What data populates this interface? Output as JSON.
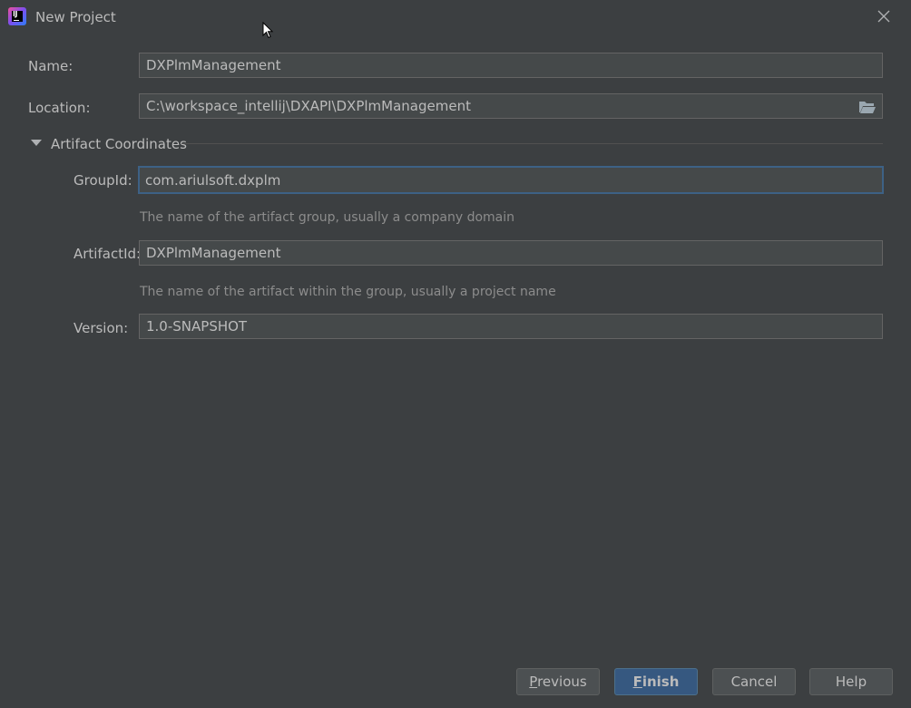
{
  "window": {
    "title": "New Project"
  },
  "form": {
    "name_label": "Name:",
    "name_value": "DXPlmManagement",
    "location_label": "Location:",
    "location_value": "C:\\workspace_intellij\\DXAPI\\DXPlmManagement",
    "section_label": "Artifact Coordinates",
    "group_label": "GroupId:",
    "group_value": "com.ariulsoft.dxplm",
    "group_hint": "The name of the artifact group, usually a company domain",
    "artifact_label": "ArtifactId:",
    "artifact_value": "DXPlmManagement",
    "artifact_hint": "The name of the artifact within the group, usually a project name",
    "version_label": "Version:",
    "version_value": "1.0-SNAPSHOT"
  },
  "buttons": {
    "previous_first": "P",
    "previous_rest": "revious",
    "finish_first": "F",
    "finish_rest": "inish",
    "cancel": "Cancel",
    "help": "Help"
  },
  "icons": {
    "app": "intellij-idea-icon",
    "close": "close-icon",
    "browse": "folder-icon",
    "expand": "triangle-down-icon"
  },
  "colors": {
    "background": "#3c3f41",
    "field_bg": "#45494a",
    "focus_border": "#3d6185",
    "primary_button": "#365880"
  }
}
